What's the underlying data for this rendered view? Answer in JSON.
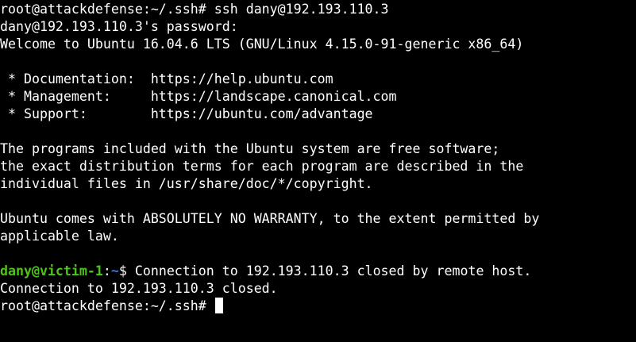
{
  "terminal": {
    "lines": [
      "root@attackdefense:~/.ssh# ssh dany@192.193.110.3",
      "dany@192.193.110.3's password:",
      "Welcome to Ubuntu 16.04.6 LTS (GNU/Linux 4.15.0-91-generic x86_64)",
      "",
      " * Documentation:  https://help.ubuntu.com",
      " * Management:     https://landscape.canonical.com",
      " * Support:        https://ubuntu.com/advantage",
      "",
      "The programs included with the Ubuntu system are free software;",
      "the exact distribution terms for each program are described in the",
      "individual files in /usr/share/doc/*/copyright.",
      "",
      "Ubuntu comes with ABSOLUTELY NO WARRANTY, to the extent permitted by",
      "applicable law.",
      ""
    ],
    "remote_prompt": {
      "user_host": "dany@victim-1",
      "separator": ":",
      "path": "~",
      "suffix": "$ ",
      "message": "Connection to 192.193.110.3 closed by remote host."
    },
    "after_lines": [
      "Connection to 192.193.110.3 closed."
    ],
    "final_prompt": "root@attackdefense:~/.ssh# ",
    "colors": {
      "background": "#000000",
      "foreground": "#ffffff",
      "prompt_user": "#4ec41a",
      "prompt_path": "#3a78d8"
    }
  }
}
